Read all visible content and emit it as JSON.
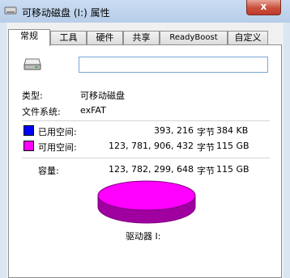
{
  "window": {
    "title": "可移动磁盘 (I:) 属性",
    "close_label": "x"
  },
  "tabs": [
    "常规",
    "工具",
    "硬件",
    "共享",
    "ReadyBoost",
    "自定义"
  ],
  "drive": {
    "name_value": "",
    "type_label": "类型:",
    "type_value": "可移动磁盘",
    "fs_label": "文件系统:",
    "fs_value": "exFAT"
  },
  "space": {
    "used": {
      "label": "已用空间:",
      "bytes": "393, 216",
      "unit": "字节",
      "size": "384 KB",
      "color": "#0000ff"
    },
    "free": {
      "label": "可用空间:",
      "bytes": "123, 781, 906, 432",
      "unit": "字节",
      "size": "115 GB",
      "color": "#ff00ff"
    },
    "capacity": {
      "label": "容量:",
      "bytes": "123, 782, 299, 648",
      "unit": "字节",
      "size": "115 GB"
    }
  },
  "pie_colors": {
    "top": "#ff00ff",
    "side": "#a000a0",
    "outline": "#800080"
  },
  "drive_label": "驱动器 I:"
}
